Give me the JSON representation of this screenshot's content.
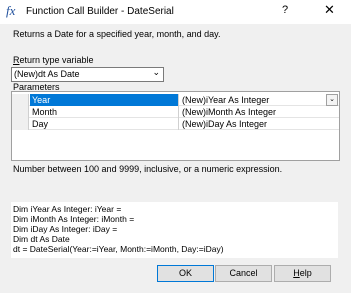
{
  "window": {
    "icon": "fx-icon",
    "title": "Function Call Builder - DateSerial",
    "help_label": "?",
    "close_label": "✕"
  },
  "description": "Returns a  Date for a specified year, month, and day.",
  "return_type": {
    "label_prefix": "R",
    "label_rest": "eturn type variable",
    "value": "(New)dt As Date"
  },
  "parameters": {
    "label_prefix": "P",
    "label_rest": "arameters",
    "rows": [
      {
        "name": "Year",
        "value": "(New)iYear As Integer",
        "selected": true
      },
      {
        "name": "Month",
        "value": "(New)iMonth As Integer",
        "selected": false
      },
      {
        "name": "Day",
        "value": "(New)iDay As Integer",
        "selected": false
      }
    ]
  },
  "hint": "Number between 100 and 9999, inclusive, or a numeric expression.",
  "code_lines": [
    "Dim iYear As Integer: iYear =",
    "Dim iMonth As Integer: iMonth =",
    "Dim iDay As Integer: iDay =",
    "Dim dt As Date",
    "dt = DateSerial(Year:=iYear, Month:=iMonth, Day:=iDay)"
  ],
  "buttons": {
    "ok": "OK",
    "cancel": "Cancel",
    "help_prefix": "H",
    "help_rest": "elp"
  }
}
